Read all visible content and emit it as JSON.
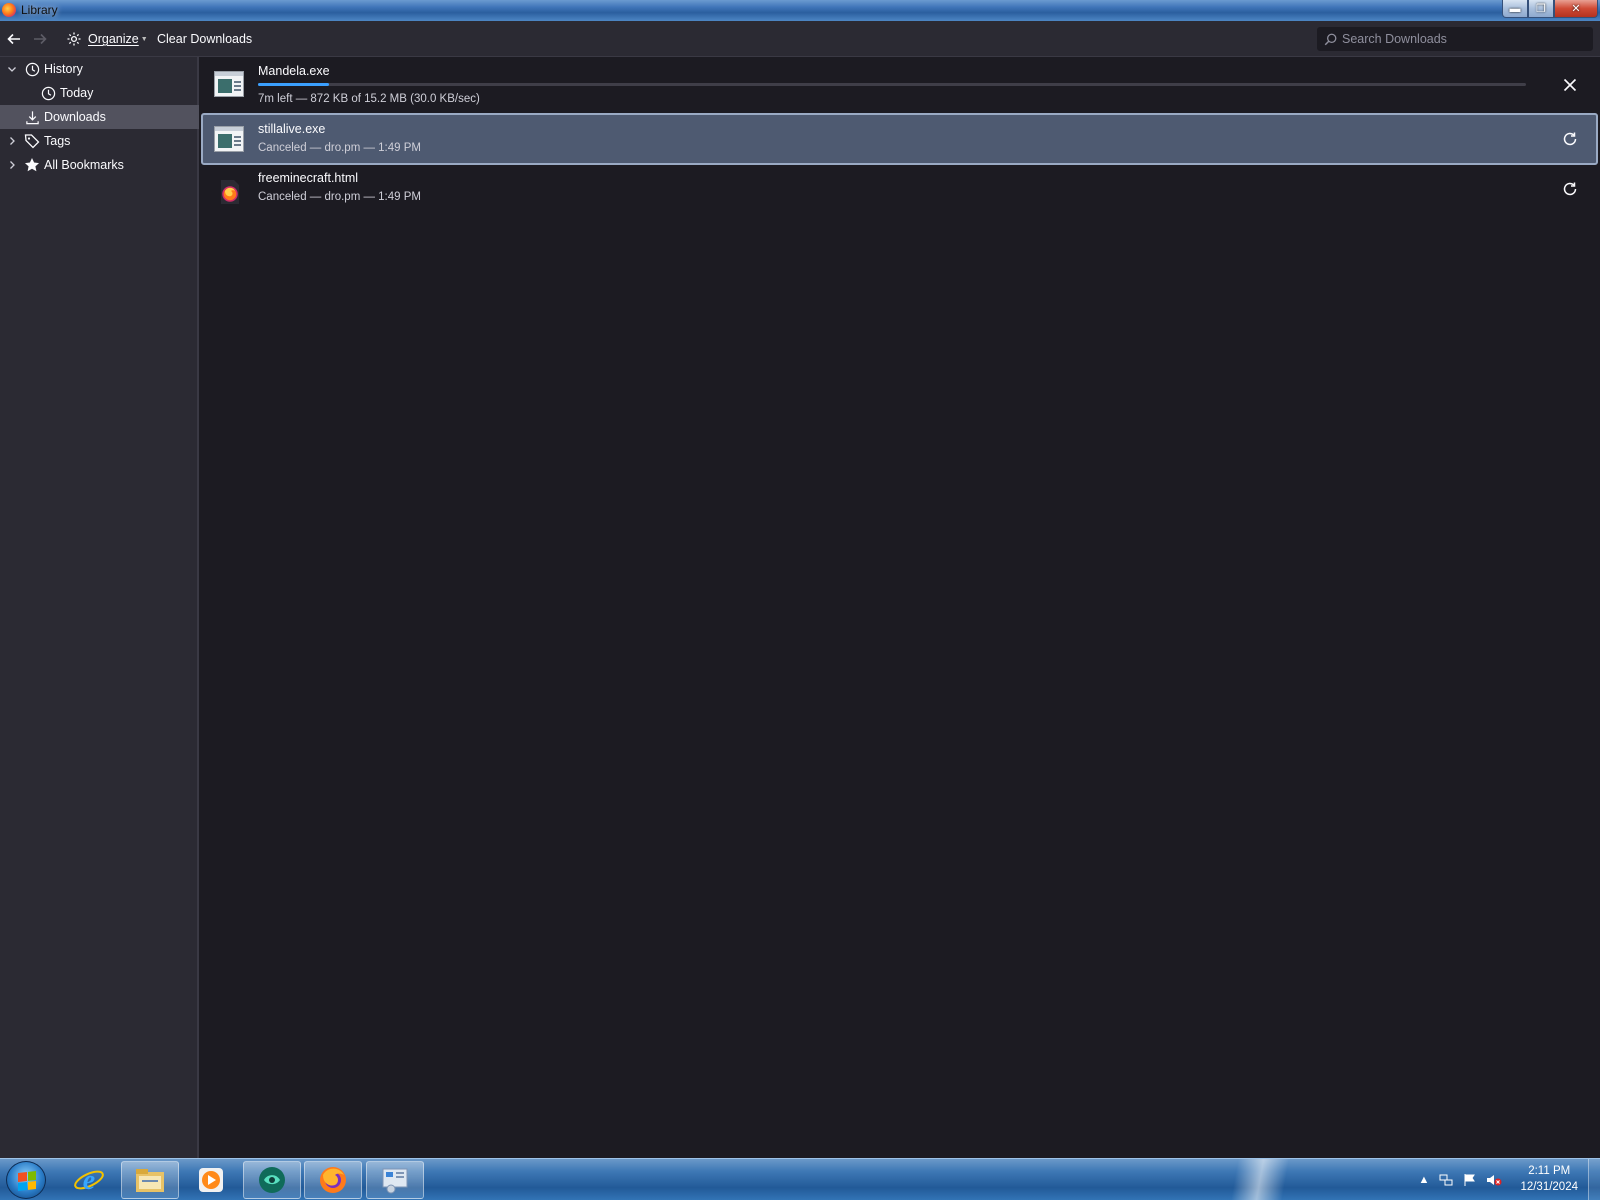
{
  "window": {
    "title": "Library",
    "controls": {
      "minimize": "minimize-icon",
      "restore": "restore-icon",
      "close": "close-icon"
    }
  },
  "toolbar": {
    "back": "back-arrow-icon",
    "forward": "forward-arrow-icon",
    "organize_label": "Organize",
    "clear_label": "Clear Downloads",
    "search_placeholder": "Search Downloads"
  },
  "sidebar": {
    "items": [
      {
        "label": "History",
        "icon": "clock-icon",
        "expandable": true,
        "expanded": true
      },
      {
        "label": "Today",
        "icon": "clock-icon",
        "child": true
      },
      {
        "label": "Downloads",
        "icon": "download-icon",
        "selected": true
      },
      {
        "label": "Tags",
        "icon": "tag-icon",
        "expandable": true,
        "expanded": false
      },
      {
        "label": "All Bookmarks",
        "icon": "star-icon",
        "expandable": true,
        "expanded": false
      }
    ]
  },
  "downloads": [
    {
      "name": "Mandela.exe",
      "status": "7m left — 872 KB of 15.2 MB (30.0 KB/sec)",
      "progress": 0.056,
      "action": "cancel-icon",
      "in_progress": true
    },
    {
      "name": "stillalive.exe",
      "status": "Canceled — dro.pm — 1:49 PM",
      "action": "retry-icon",
      "selected": true
    },
    {
      "name": "freeminecraft.html",
      "status": "Canceled — dro.pm — 1:49 PM",
      "action": "retry-icon"
    }
  ],
  "taskbar": {
    "apps": [
      "internet-explorer-icon",
      "file-explorer-icon",
      "media-player-icon",
      "app-icon",
      "firefox-icon",
      "control-panel-icon"
    ],
    "clock_time": "2:11 PM",
    "clock_date": "12/31/2024"
  },
  "colors": {
    "window_bg": "#1c1b22",
    "toolbar_bg": "#2b2a33",
    "selected_row": "#4e5a71",
    "progress": "#3ba0ff"
  }
}
